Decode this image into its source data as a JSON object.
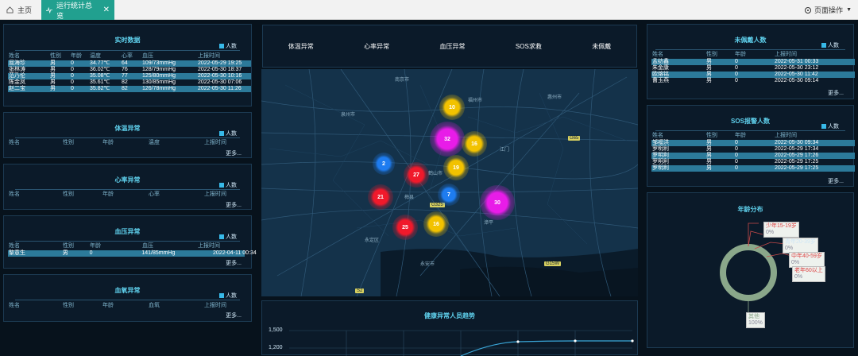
{
  "tabs": {
    "home": "主页",
    "active": "运行统计总览",
    "page_ops": "页面操作"
  },
  "colors": {
    "panel_title": "#5fd0ec",
    "highlight_row": "#2c7a9a",
    "tab_active": "#21a08f"
  },
  "realtime": {
    "title": "实时数据",
    "legend": "人数",
    "headers": [
      "姓名",
      "性别",
      "年龄",
      "温度",
      "心率",
      "血压",
      "上报时间"
    ],
    "rows": [
      [
        "屈海珍",
        "男",
        "0",
        "34.77℃",
        "64",
        "109/73mmHg",
        "2022-05-29 19:25"
      ],
      [
        "张林涛",
        "男",
        "0",
        "36.02℃",
        "76",
        "128/79mmHg",
        "2022-05-30 18:37"
      ],
      [
        "范乃伦",
        "男",
        "0",
        "35.08℃",
        "77",
        "125/80mmHg",
        "2022-05-30 10:16"
      ],
      [
        "陈金凤",
        "男",
        "0",
        "35.61℃",
        "82",
        "130/85mmHg",
        "2022-05-30 07:06"
      ],
      [
        "赵二宝",
        "男",
        "0",
        "35.82℃",
        "82",
        "126/78mmHg",
        "2022-05-30 11:26"
      ]
    ]
  },
  "temp": {
    "title": "体温异常",
    "legend": "人数",
    "headers": [
      "姓名",
      "性别",
      "年龄",
      "温度",
      "上报时间"
    ],
    "more": "更多..."
  },
  "heart": {
    "title": "心率异常",
    "legend": "人数",
    "headers": [
      "姓名",
      "性别",
      "年龄",
      "心率",
      "上报时间"
    ],
    "more": "更多..."
  },
  "bp": {
    "title": "血压异常",
    "legend": "人数",
    "headers": [
      "姓名",
      "性别",
      "年龄",
      "血压",
      "上报时间"
    ],
    "rows": [
      [
        "黎意生",
        "男",
        "0",
        "141/85mmHg",
        "2022-04-11 00:34"
      ]
    ],
    "more": "更多..."
  },
  "oxygen": {
    "title": "血氧异常",
    "legend": "人数",
    "headers": [
      "姓名",
      "性别",
      "年龄",
      "血氧",
      "上报时间"
    ],
    "more": "更多..."
  },
  "map_tabs": [
    "体温异常",
    "心率异常",
    "血压异常",
    "SOS求救",
    "未佩戴"
  ],
  "map_labels": [
    "南京市",
    "福州市",
    "惠州市",
    "泉州市",
    "江门",
    "鹤山市",
    "梅县",
    "漳平",
    "永定区",
    "永安市",
    "G65",
    "G325",
    "G15W",
    "S2"
  ],
  "clusters": [
    {
      "v": "10",
      "color": "#f2c200"
    },
    {
      "v": "32",
      "color": "#e81ce8"
    },
    {
      "v": "16",
      "color": "#f2c200"
    },
    {
      "v": "2",
      "color": "#1e7cf0"
    },
    {
      "v": "27",
      "color": "#f0192b"
    },
    {
      "v": "19",
      "color": "#f2c200"
    },
    {
      "v": "7",
      "color": "#1e7cf0"
    },
    {
      "v": "21",
      "color": "#f0192b"
    },
    {
      "v": "30",
      "color": "#e81ce8"
    },
    {
      "v": "25",
      "color": "#f0192b"
    },
    {
      "v": "16",
      "color": "#f2c200"
    }
  ],
  "trend": {
    "title": "健康异常人员趋势",
    "yticks": [
      "1,500",
      "1,200"
    ]
  },
  "notworn": {
    "title": "未佩戴人数",
    "legend": "人数",
    "headers": [
      "姓名",
      "性别",
      "年龄",
      "上报时间"
    ],
    "rows": [
      [
        "孟纺鑫",
        "男",
        "0",
        "2022-05-31 00:33"
      ],
      [
        "朱金康",
        "男",
        "0",
        "2022-05-30 23:12"
      ],
      [
        "欧熔铭",
        "男",
        "0",
        "2022-05-30 11:42"
      ],
      [
        "曹玉燕",
        "男",
        "0",
        "2022-05-30 09:14"
      ]
    ],
    "more": "更多..."
  },
  "sos": {
    "title": "SOS报警人数",
    "legend": "人数",
    "headers": [
      "姓名",
      "性别",
      "年龄",
      "上报时间"
    ],
    "rows": [
      [
        "邹福洪",
        "男",
        "0",
        "2022-05-30 09:34"
      ],
      [
        "罗明利",
        "男",
        "0",
        "2022-05-29 17:34"
      ],
      [
        "罗明利",
        "男",
        "0",
        "2022-05-29 17:26"
      ],
      [
        "罗明利",
        "男",
        "0",
        "2022-05-29 17:25"
      ],
      [
        "罗明利",
        "男",
        "0",
        "2022-05-29 17:25"
      ]
    ],
    "more": "更多..."
  },
  "age": {
    "title": "年龄分布",
    "labels": [
      {
        "t": "少年15-19岁",
        "p": "0%"
      },
      {
        "t": "青年20-39岁",
        "p": "0%"
      },
      {
        "t": "中年40-59岁",
        "p": "0%"
      },
      {
        "t": "老年60以上",
        "p": "0%"
      },
      {
        "t": "其他",
        "p": "100%"
      }
    ]
  }
}
